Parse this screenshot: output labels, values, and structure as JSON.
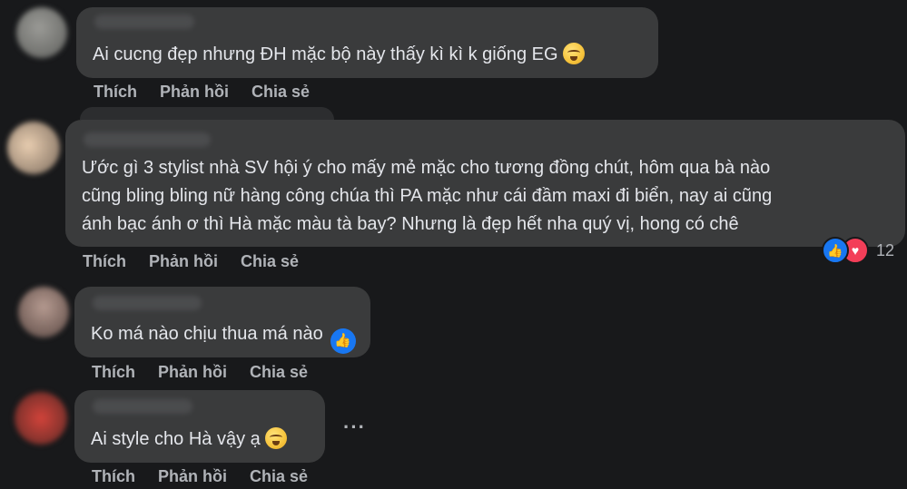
{
  "comments": [
    {
      "text": "Ai cucng đẹp nhưng ĐH mặc bộ này thấy kì kì k giống EG",
      "emoji": "crying-face-emoji",
      "actions": {
        "like": "Thích",
        "reply": "Phản hồi",
        "share": "Chia sẻ"
      }
    },
    {
      "lines": [
        "Ước gì 3 stylist nhà SV hội ý cho mấy mẻ mặc cho tương đồng chút, hôm qua bà nào",
        "cũng bling bling nữ hàng công chúa thì PA mặc như cái đầm maxi đi biển, nay ai cũng",
        "ánh bạc ánh ơ thì Hà mặc màu tà bay? Nhưng là đẹp hết nha quý vị, hong có chê"
      ],
      "reactions": {
        "icons": [
          "like-icon",
          "love-icon"
        ],
        "count": "12"
      },
      "actions": {
        "like": "Thích",
        "reply": "Phản hồi",
        "share": "Chia sẻ"
      }
    },
    {
      "text": "Ko má nào chịu thua má nào",
      "emoji": "like-emoji",
      "actions": {
        "like": "Thích",
        "reply": "Phản hồi",
        "share": "Chia sẻ"
      }
    },
    {
      "text": "Ai style cho Hà vậy ạ",
      "emoji": "crying-face-emoji",
      "more": "···",
      "actions": {
        "like": "Thích",
        "reply": "Phản hồi",
        "share": "Chia sẻ"
      }
    }
  ],
  "colors": {
    "background": "#18191b",
    "bubble": "#3a3b3c",
    "text": "#e4e6eb",
    "secondary_text": "#b0b3b8",
    "like_blue": "#1877f2",
    "love_red": "#f33e58"
  }
}
